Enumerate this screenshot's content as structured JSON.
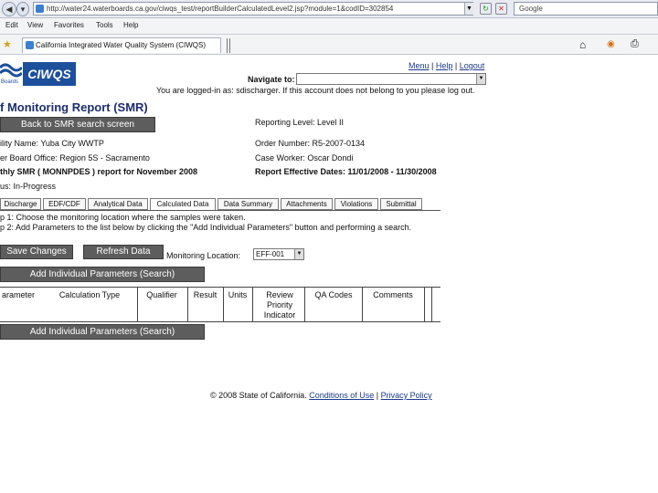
{
  "browser": {
    "url": "http://water24.waterboards.ca.gov/ciwqs_test/reportBuilderCalculatedLevel2.jsp?module=1&codID=302854",
    "search": "Google",
    "menu": [
      "Edit",
      "View",
      "Favorites",
      "Tools",
      "Help"
    ],
    "tab_title": "California Integrated Water Quality System (CIWQS)"
  },
  "header": {
    "logo_text": "CIWQS",
    "logo_caption": "Boards",
    "links": [
      "Menu",
      "Help",
      "Logout"
    ],
    "navigate_label": "Navigate to:",
    "logged_in_msg": "You are logged-in as: sdischarger. If this account does not belong to you please log out."
  },
  "page": {
    "title": "f Monitoring Report (SMR)",
    "back_button": "Back to SMR search screen",
    "reporting_level": "Reporting Level: Level II",
    "facility": "ility Name: Yuba City WWTP",
    "order_number": "Order Number: R5-2007-0134",
    "board_office": "er Board Office: Region 5S - Sacramento",
    "case_worker": "Case Worker: Oscar Dondi",
    "report_for": "thly SMR ( MONNPDES ) report for November 2008",
    "effective_dates": "Report Effective Dates: 11/01/2008 - 11/30/2008",
    "status": "us: In-Progress"
  },
  "tabs": [
    "Discharge",
    "EDF/CDF",
    "Analytical Data",
    "Calculated Data",
    "Data Summary",
    "Attachments",
    "Violations",
    "Submittal"
  ],
  "steps": {
    "step1": "p 1: Choose the monitoring location where the samples were taken.",
    "step2": "p 2: Add Parameters to the list below by clicking the \"Add Individual Parameters\" button and performing a search."
  },
  "actions": {
    "save": "Save Changes",
    "refresh": "Refresh Data",
    "location_label": "Monitoring Location:",
    "location_value": "EFF-001",
    "add_params": "Add Individual Parameters (Search)"
  },
  "table": {
    "columns": [
      "arameter",
      "Calculation Type",
      "Qualifier",
      "Result",
      "Units",
      "Review Priority Indicator",
      "QA Codes",
      "Comments"
    ]
  },
  "footer": {
    "copyright": "© 2008 State of California.",
    "conditions": "Conditions of Use",
    "privacy": "Privacy Policy"
  },
  "colors": {
    "button_bg": "#5d5d5d",
    "logo_bg": "#1c4f9c",
    "title": "#1b2e6e",
    "link": "#1b3a8c"
  }
}
